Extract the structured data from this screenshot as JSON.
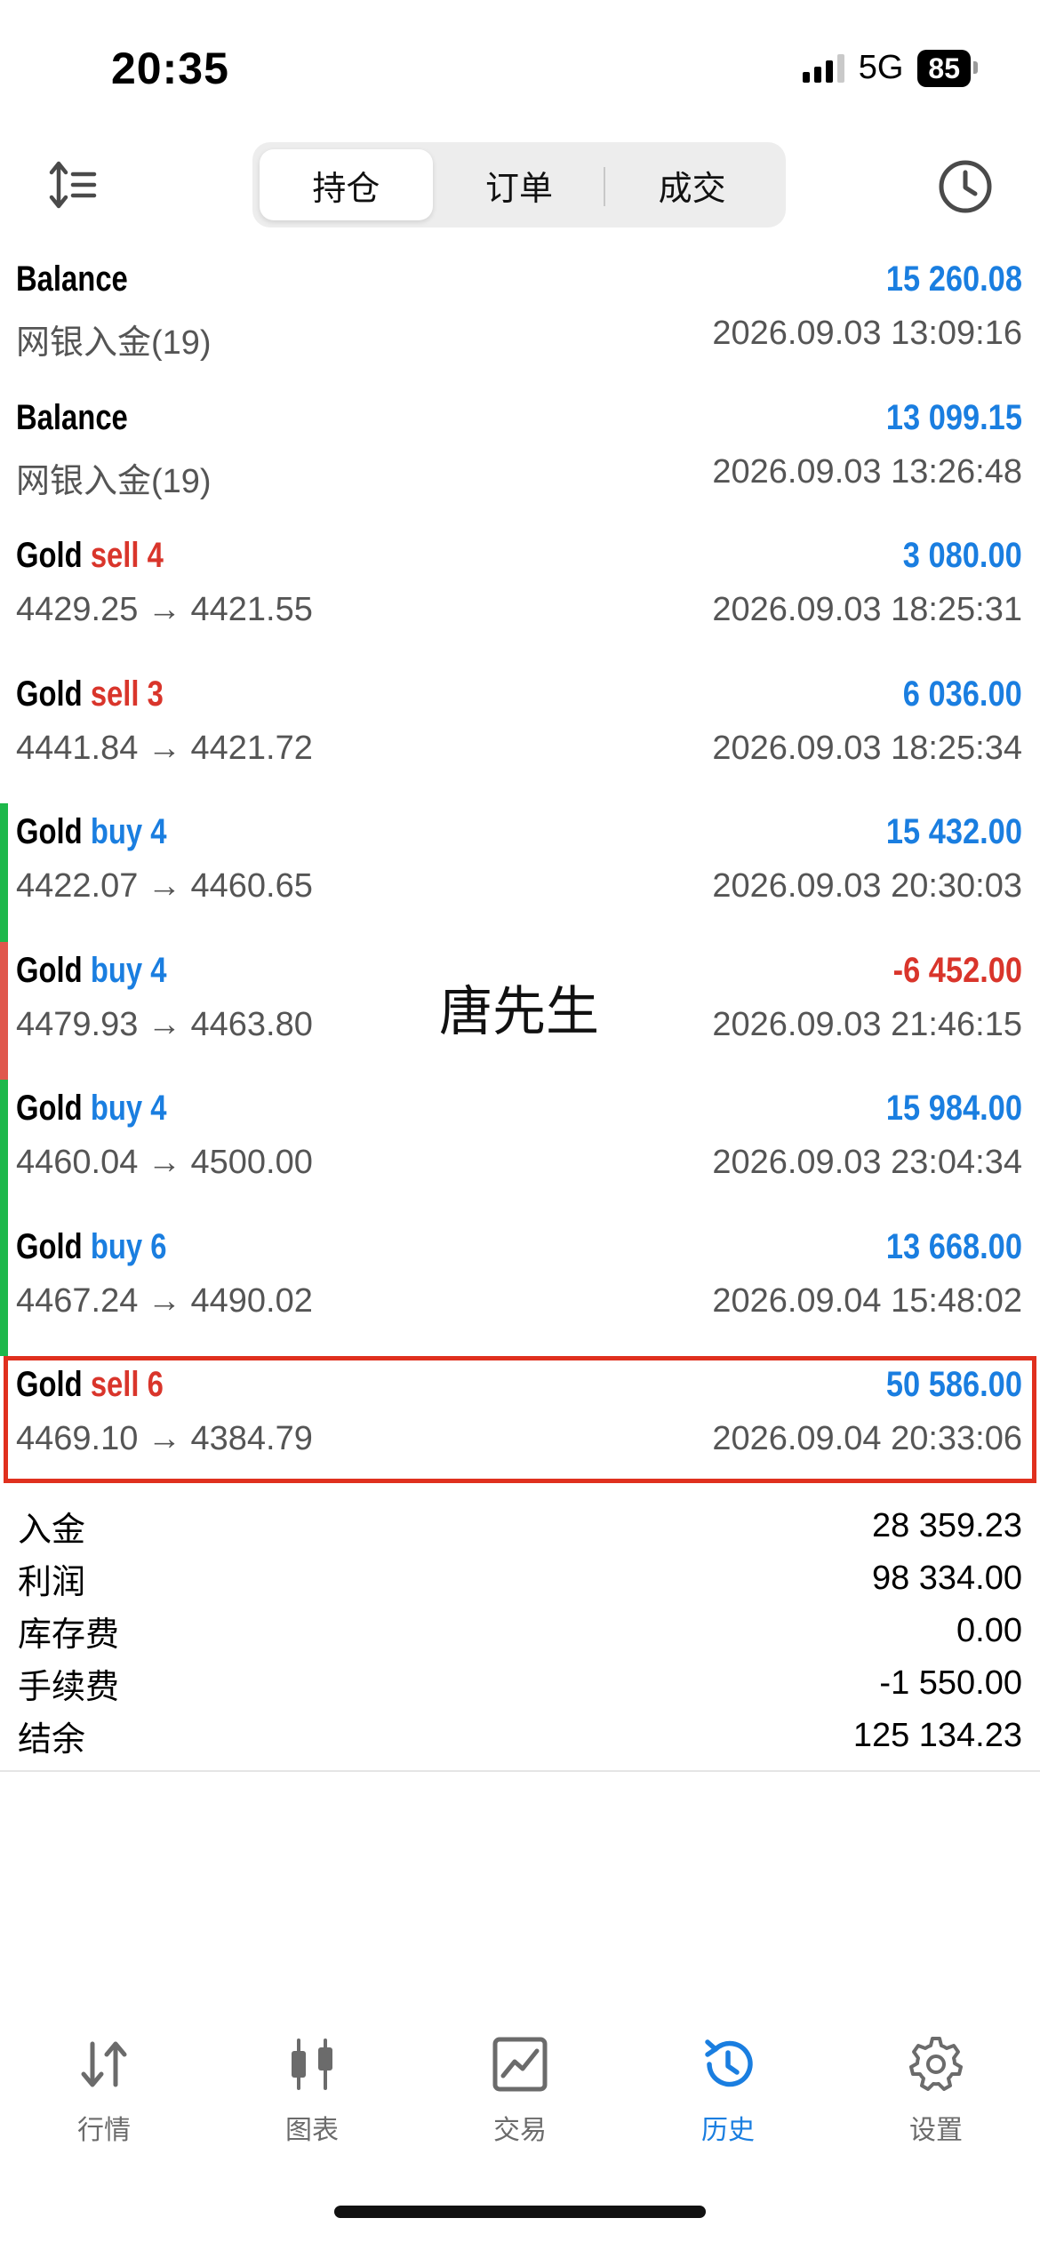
{
  "status": {
    "time": "20:35",
    "network": "5G",
    "battery": "85"
  },
  "tabs": [
    {
      "label": "持仓",
      "active": true
    },
    {
      "label": "订单",
      "active": false
    },
    {
      "label": "成交",
      "active": false
    }
  ],
  "deals": [
    {
      "symbol": "Balance",
      "action": "",
      "volume": "",
      "detail": "网银入金(19)",
      "amount": "15 260.08",
      "amount_color": "#1a7ee0",
      "time": "2026.09.03 13:09:16",
      "bar": ""
    },
    {
      "symbol": "Balance",
      "action": "",
      "volume": "",
      "detail": "网银入金(19)",
      "amount": "13 099.15",
      "amount_color": "#1a7ee0",
      "time": "2026.09.03 13:26:48",
      "bar": ""
    },
    {
      "symbol": "Gold",
      "action": "sell",
      "volume": "4",
      "detail": "4429.25 → 4421.55",
      "amount": "3 080.00",
      "amount_color": "#1a7ee0",
      "time": "2026.09.03 18:25:31",
      "bar": ""
    },
    {
      "symbol": "Gold",
      "action": "sell",
      "volume": "3",
      "detail": "4441.84 → 4421.72",
      "amount": "6 036.00",
      "amount_color": "#1a7ee0",
      "time": "2026.09.03 18:25:34",
      "bar": ""
    },
    {
      "symbol": "Gold",
      "action": "buy",
      "volume": "4",
      "detail": "4422.07 → 4460.65",
      "amount": "15 432.00",
      "amount_color": "#1a7ee0",
      "time": "2026.09.03 20:30:03",
      "bar": "#1db84a"
    },
    {
      "symbol": "Gold",
      "action": "buy",
      "volume": "4",
      "detail": "4479.93 → 4463.80",
      "amount": "-6 452.00",
      "amount_color": "#d9352b",
      "time": "2026.09.03 21:46:15",
      "bar": "#e0574c"
    },
    {
      "symbol": "Gold",
      "action": "buy",
      "volume": "4",
      "detail": "4460.04 → 4500.00",
      "amount": "15 984.00",
      "amount_color": "#1a7ee0",
      "time": "2026.09.03 23:04:34",
      "bar": "#1db84a"
    },
    {
      "symbol": "Gold",
      "action": "buy",
      "volume": "6",
      "detail": "4467.24 → 4490.02",
      "amount": "13 668.00",
      "amount_color": "#1a7ee0",
      "time": "2026.09.04 15:48:02",
      "bar": "#1db84a"
    },
    {
      "symbol": "Gold",
      "action": "sell",
      "volume": "6",
      "detail": "4469.10 → 4384.79",
      "amount": "50 586.00",
      "amount_color": "#1a7ee0",
      "time": "2026.09.04 20:33:06",
      "bar": ""
    }
  ],
  "watermark": "唐先生",
  "summary": [
    {
      "label": "入金",
      "value": "28 359.23"
    },
    {
      "label": "利润",
      "value": "98 334.00"
    },
    {
      "label": "库存费",
      "value": "0.00"
    },
    {
      "label": "手续费",
      "value": "-1 550.00"
    },
    {
      "label": "结余",
      "value": "125 134.23"
    }
  ],
  "nav": [
    {
      "label": "行情",
      "icon": "quotes-icon",
      "active": false
    },
    {
      "label": "图表",
      "icon": "chart-icon",
      "active": false
    },
    {
      "label": "交易",
      "icon": "trade-icon",
      "active": false
    },
    {
      "label": "历史",
      "icon": "history-icon",
      "active": true
    },
    {
      "label": "设置",
      "icon": "settings-icon",
      "active": false
    }
  ],
  "colors": {
    "accent": "#1a7ee0",
    "sell": "#d9352b",
    "profit_bar": "#1db84a",
    "loss_bar": "#e0574c",
    "highlight": "#e0301e"
  }
}
